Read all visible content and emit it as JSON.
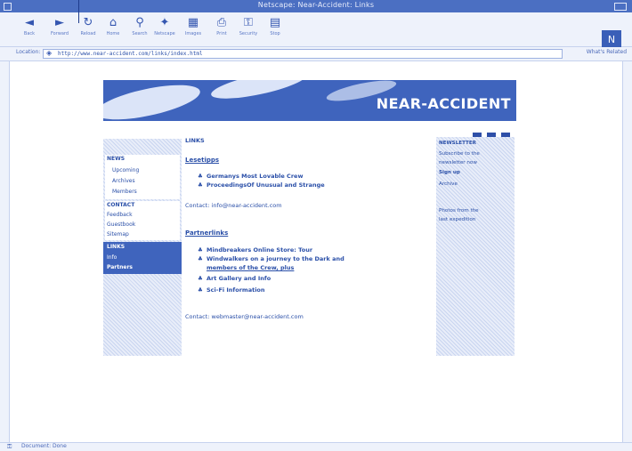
{
  "window": {
    "title": "Netscape: Near-Accident: Links"
  },
  "toolbar": {
    "buttons": [
      {
        "label": "Back"
      },
      {
        "label": "Forward"
      },
      {
        "label": "Reload"
      },
      {
        "label": "Home"
      },
      {
        "label": "Search"
      },
      {
        "label": "Netscape"
      },
      {
        "label": "Images"
      },
      {
        "label": "Print"
      },
      {
        "label": "Security"
      },
      {
        "label": "Stop"
      }
    ]
  },
  "location": {
    "label": "Location:",
    "url": "http://www.near-accident.com/links/index.html",
    "related": "What's Related"
  },
  "banner": {
    "logo": "NEAR-ACCIDENT"
  },
  "nav": {
    "items": [
      "NEWS",
      "Upcoming",
      "Archives",
      "Members",
      "CONTACT",
      "Feedback",
      "Guestbook",
      "Sitemap",
      "LINKS",
      "Info",
      "Partners"
    ]
  },
  "main": {
    "top_label": "LINKS",
    "section1_title": "Lesetipps",
    "section1_items": [
      "Germanys Most Lovable Crew",
      "ProceedingsOf Unusual and Strange"
    ],
    "section1_contact": "Contact: info@near-accident.com",
    "section2_title": "Partnerlinks",
    "section2_items": [
      "Mindbreakers Online Store: Tour",
      "Windwalkers on a journey to the Dark and",
      "members of the Crew, plus",
      "Art Gallery and Info",
      "Sci-Fi Information"
    ],
    "section2_contact": "Contact: webmaster@near-accident.com"
  },
  "rightcol": {
    "lines": [
      "NEWSLETTER",
      "Subscribe to the",
      "newsletter now",
      "Sign up",
      "Archive",
      "Photos from the",
      "last expedition"
    ]
  },
  "status": {
    "text": "Document: Done"
  }
}
